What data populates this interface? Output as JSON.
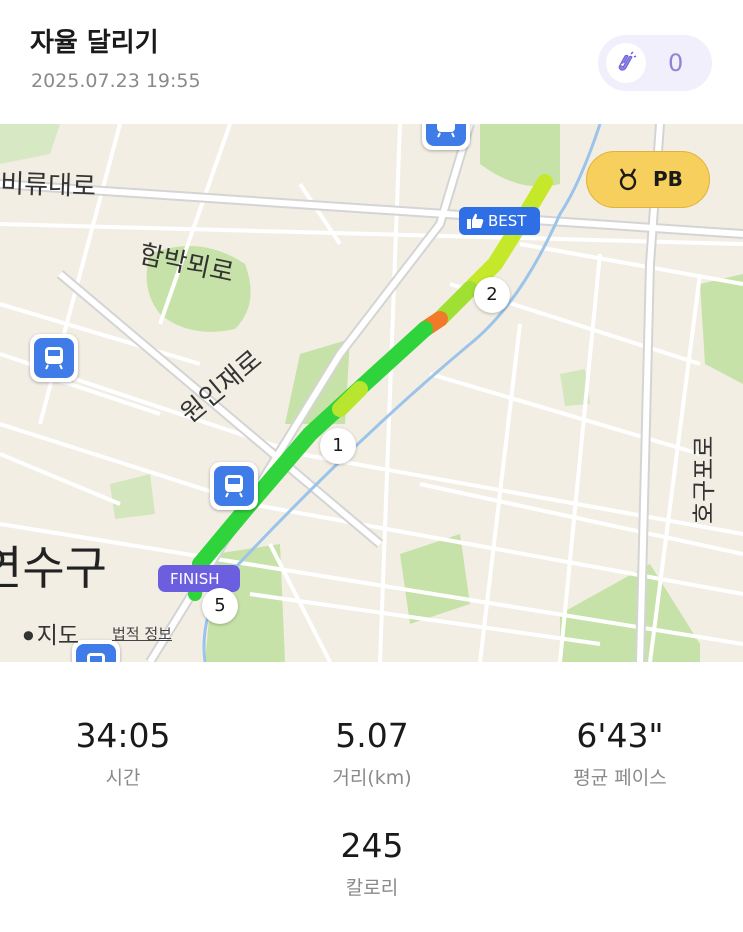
{
  "header": {
    "title": "자율 달리기",
    "datetime": "2025.07.23 19:55"
  },
  "clap": {
    "icon": "clap-hands-icon",
    "count": "0"
  },
  "map": {
    "streets": [
      "비류대로",
      "함박뫼로",
      "원인재로",
      "호구포로",
      "연수구"
    ],
    "badges": {
      "pb": "PB",
      "best": "BEST",
      "finish": "FINISH"
    },
    "km_markers": [
      "1",
      "2",
      "5"
    ],
    "attribution": {
      "brand": "지도",
      "legal": "법적 정보"
    }
  },
  "stats": [
    {
      "value": "34:05",
      "label": "시간"
    },
    {
      "value": "5.07",
      "label": "거리(km)"
    },
    {
      "value": "6'43\"",
      "label": "평균 페이스"
    },
    {
      "value": "245",
      "label": "칼로리"
    }
  ],
  "colors": {
    "route_fast": "#2fd33b",
    "route_mid": "#c5e82a",
    "route_slow": "#f07a2a",
    "accent": "#6b5fe0",
    "pb": "#f6cf5c",
    "best": "#2f6fe6",
    "station": "#3f7ce8"
  }
}
